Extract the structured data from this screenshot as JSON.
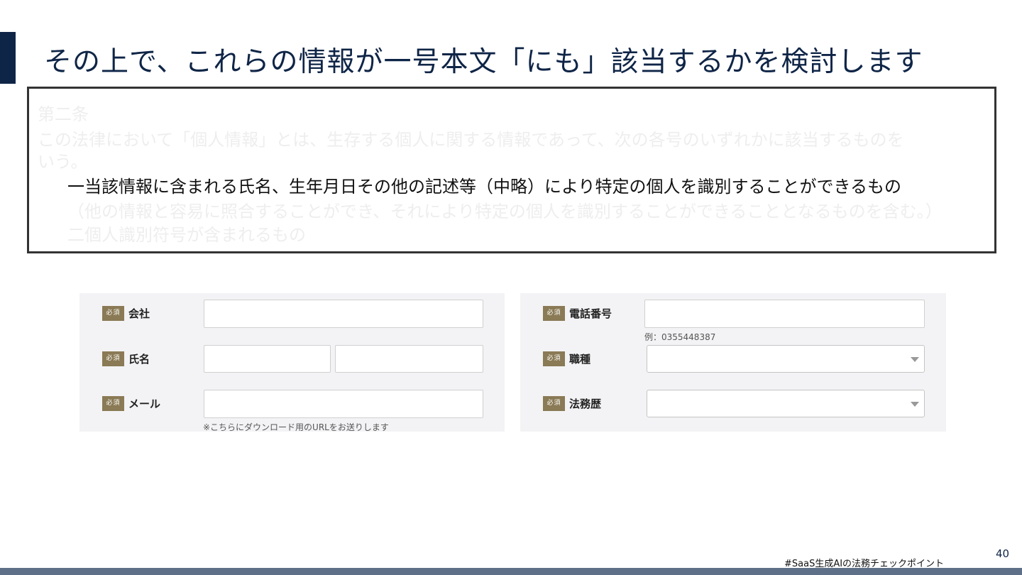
{
  "slide": {
    "title": "その上で、これらの情報が一号本文「にも」該当するかを検討します",
    "page_number": "40",
    "hashtag": "#SaaS生成AIの法務チェックポイント"
  },
  "law_text": {
    "lines": [
      "第二条",
      "この法律において「個人情報」とは、生存する個人に関する情報であって、次の各号のいずれかに該当するものを",
      "いう。",
      "一当該情報に含まれる氏名、生年月日その他の記述等（中略）により特定の個人を識別することができるもの",
      "（他の情報と容易に照合することができ、それにより特定の個人を識別することができることとなるものを含む。）",
      "二個人識別符号が含まれるもの"
    ]
  },
  "form": {
    "required_badge": "必須",
    "left": {
      "company_label": "会社",
      "name_label": "氏名",
      "email_label": "メール",
      "email_note": "※こちらにダウンロード用のURLをお送りします"
    },
    "right": {
      "phone_label": "電話番号",
      "phone_example": "例：0355448387",
      "job_label": "職種",
      "legal_experience_label": "法務歴"
    }
  },
  "colors": {
    "title_navy": "#0f2547",
    "badge_gold": "#8a7a55",
    "panel_bg": "#f3f3f5",
    "bottom_bar": "#5e7088"
  }
}
